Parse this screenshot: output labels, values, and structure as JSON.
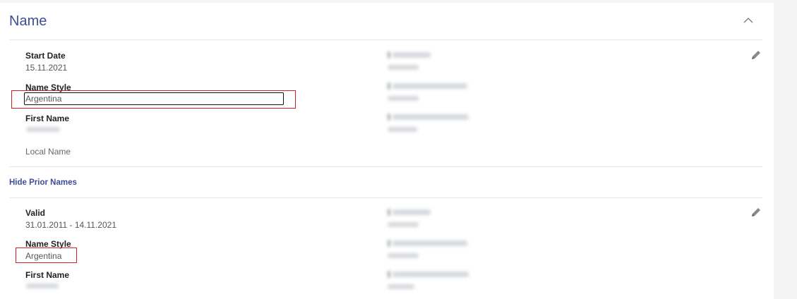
{
  "section": {
    "title": "Name"
  },
  "current": {
    "start_date_label": "Start Date",
    "start_date_value": "15.11.2021",
    "name_style_label": "Name Style",
    "name_style_value": "Argentina",
    "first_name_label": "First Name",
    "local_name_label": "Local Name"
  },
  "prior": {
    "toggle_label": "Hide Prior Names",
    "valid_label": "Valid",
    "valid_value": "31.01.2011 - 14.11.2021",
    "name_style_label": "Name Style",
    "name_style_value": "Argentina",
    "first_name_label": "First Name"
  },
  "icons": {
    "collapse": "chevron-up-icon",
    "edit": "pencil-icon"
  },
  "colors": {
    "accent": "#3d4d9a",
    "highlight": "#d0201f"
  }
}
